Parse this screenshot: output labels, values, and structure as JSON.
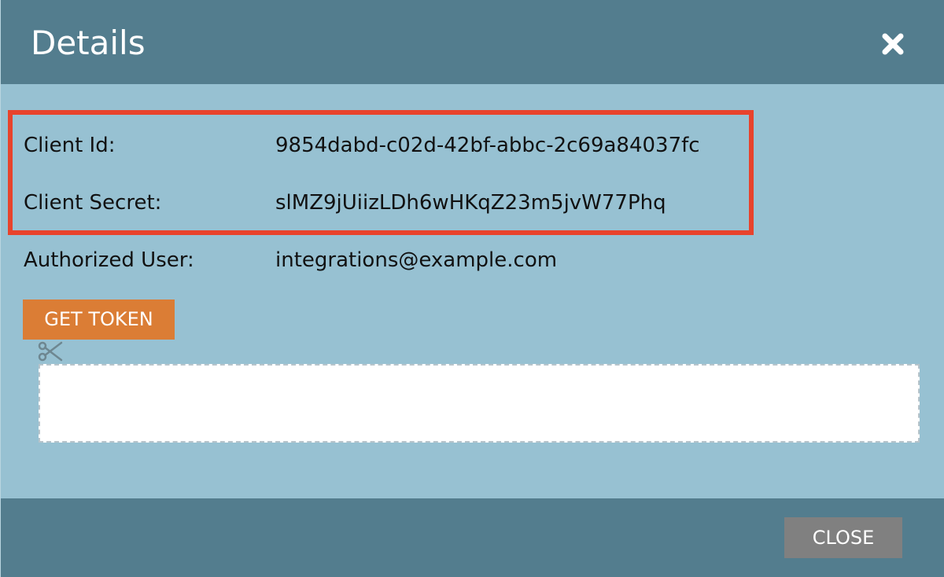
{
  "dialog": {
    "title": "Details",
    "close_icon": "close-x-icon"
  },
  "details": {
    "client_id_label": "Client Id:",
    "client_id_value": "9854dabd-c02d-42bf-abbc-2c69a84037fc",
    "client_secret_label": "Client Secret:",
    "client_secret_value": "slMZ9jUiizLDh6wHKqZ23m5jvW77Phq",
    "authorized_user_label": "Authorized User:",
    "authorized_user_value": "integrations@example.com"
  },
  "actions": {
    "get_token_label": "GET TOKEN",
    "copy_icon": "scissors-icon",
    "token_value": "",
    "close_label": "CLOSE"
  },
  "colors": {
    "header_bg": "#537d8e",
    "body_bg": "#97c1d2",
    "highlight_border": "#e8432c",
    "get_token_bg": "#db7d35",
    "close_bg": "#808080"
  }
}
